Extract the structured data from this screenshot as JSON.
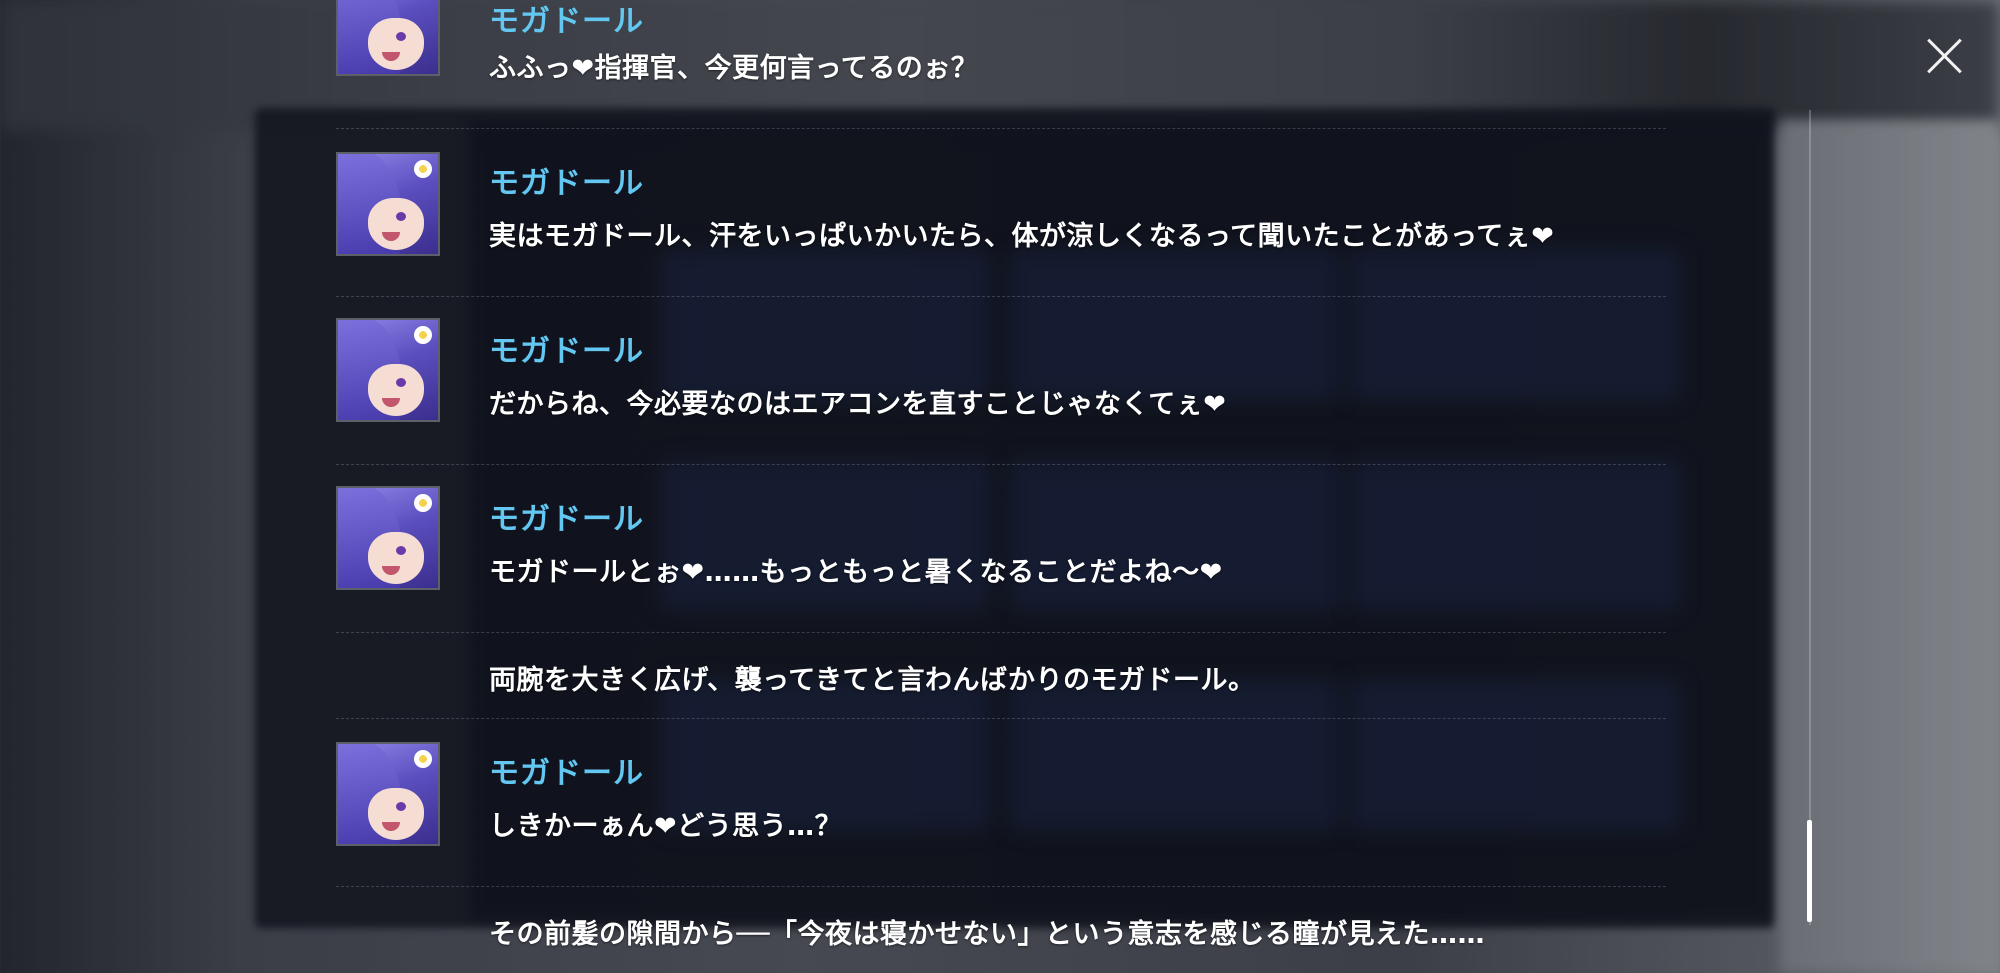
{
  "close_icon": "close-icon",
  "log": {
    "entries": [
      {
        "type": "dialogue",
        "speaker": "モガドール",
        "text": "ふふっ❤指揮官、今更何言ってるのぉ？"
      },
      {
        "type": "dialogue",
        "speaker": "モガドール",
        "text": "実はモガドール、汗をいっぱいかいたら、体が涼しくなるって聞いたことがあってぇ❤"
      },
      {
        "type": "dialogue",
        "speaker": "モガドール",
        "text": "だからね、今必要なのはエアコンを直すことじゃなくてぇ❤"
      },
      {
        "type": "dialogue",
        "speaker": "モガドール",
        "text": "モガドールとぉ❤……もっともっと暑くなることだよね〜❤"
      },
      {
        "type": "narration",
        "text": "両腕を大きく広げ、襲ってきてと言わんばかりのモガドール。"
      },
      {
        "type": "dialogue",
        "speaker": "モガドール",
        "text": "しきかーぁん❤どう思う…？"
      },
      {
        "type": "narration",
        "text": "その前髪の隙間から──「今夜は寝かせない」という意志を感じる瞳が見えた……"
      }
    ]
  },
  "colors": {
    "speaker_name": "#63c7f2",
    "dialogue_text": "#ffffff",
    "panel": "#141821"
  }
}
